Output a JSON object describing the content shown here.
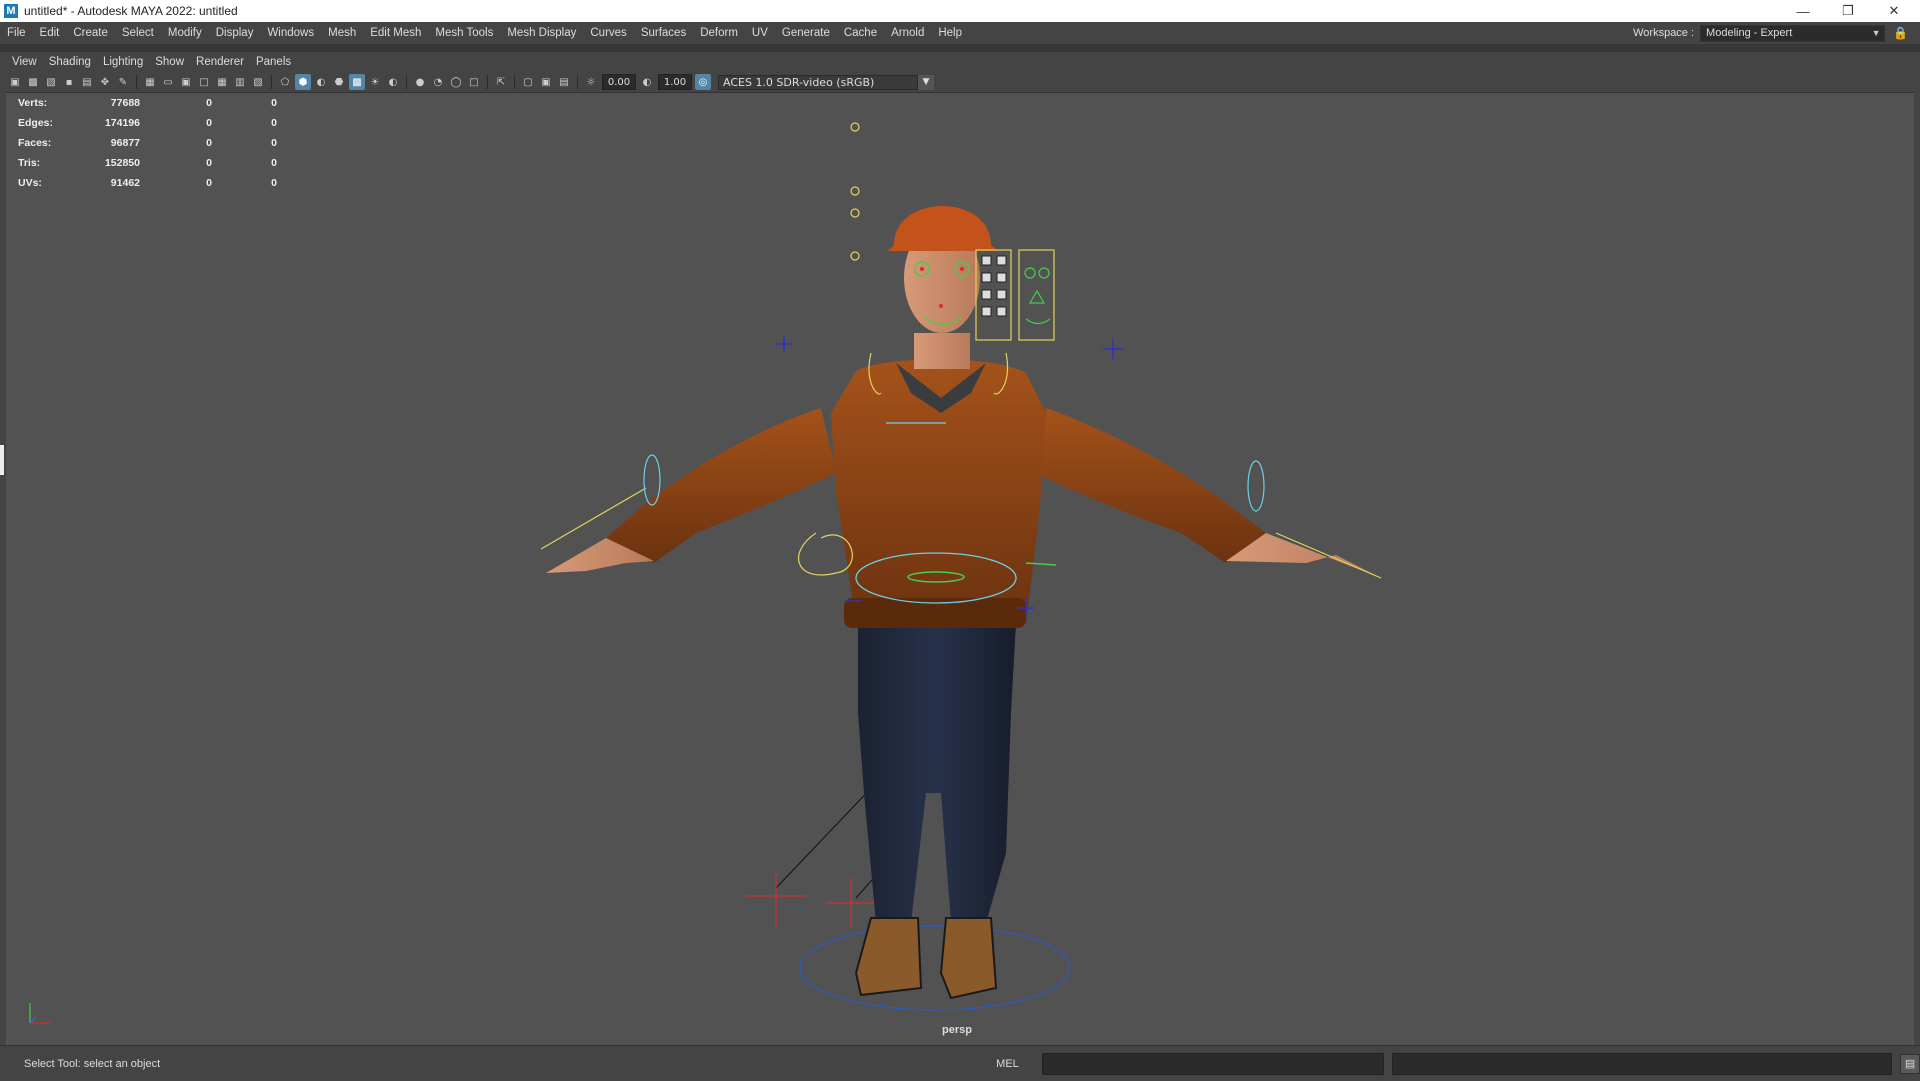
{
  "window": {
    "title": "untitled* - Autodesk MAYA 2022: untitled",
    "logo_letter": "M"
  },
  "menubar": {
    "items": [
      "File",
      "Edit",
      "Create",
      "Select",
      "Modify",
      "Display",
      "Windows",
      "Mesh",
      "Edit Mesh",
      "Mesh Tools",
      "Mesh Display",
      "Curves",
      "Surfaces",
      "Deform",
      "UV",
      "Generate",
      "Cache",
      "Arnold",
      "Help"
    ]
  },
  "workspace": {
    "label": "Workspace :",
    "value": "Modeling - Expert"
  },
  "panel_menu": {
    "items": [
      "View",
      "Shading",
      "Lighting",
      "Show",
      "Renderer",
      "Panels"
    ]
  },
  "toolbar": {
    "exposure": "0.00",
    "gamma": "1.00",
    "color_space": "ACES 1.0 SDR-video (sRGB)"
  },
  "hud": {
    "rows": [
      {
        "label": "Verts:",
        "v1": "77688",
        "v2": "0",
        "v3": "0"
      },
      {
        "label": "Edges:",
        "v1": "174196",
        "v2": "0",
        "v3": "0"
      },
      {
        "label": "Faces:",
        "v1": "96877",
        "v2": "0",
        "v3": "0"
      },
      {
        "label": "Tris:",
        "v1": "152850",
        "v2": "0",
        "v3": "0"
      },
      {
        "label": "UVs:",
        "v1": "91462",
        "v2": "0",
        "v3": "0"
      }
    ]
  },
  "viewport": {
    "camera": "persp"
  },
  "status": {
    "help_text": "Select Tool: select an object",
    "mel_label": "MEL"
  }
}
